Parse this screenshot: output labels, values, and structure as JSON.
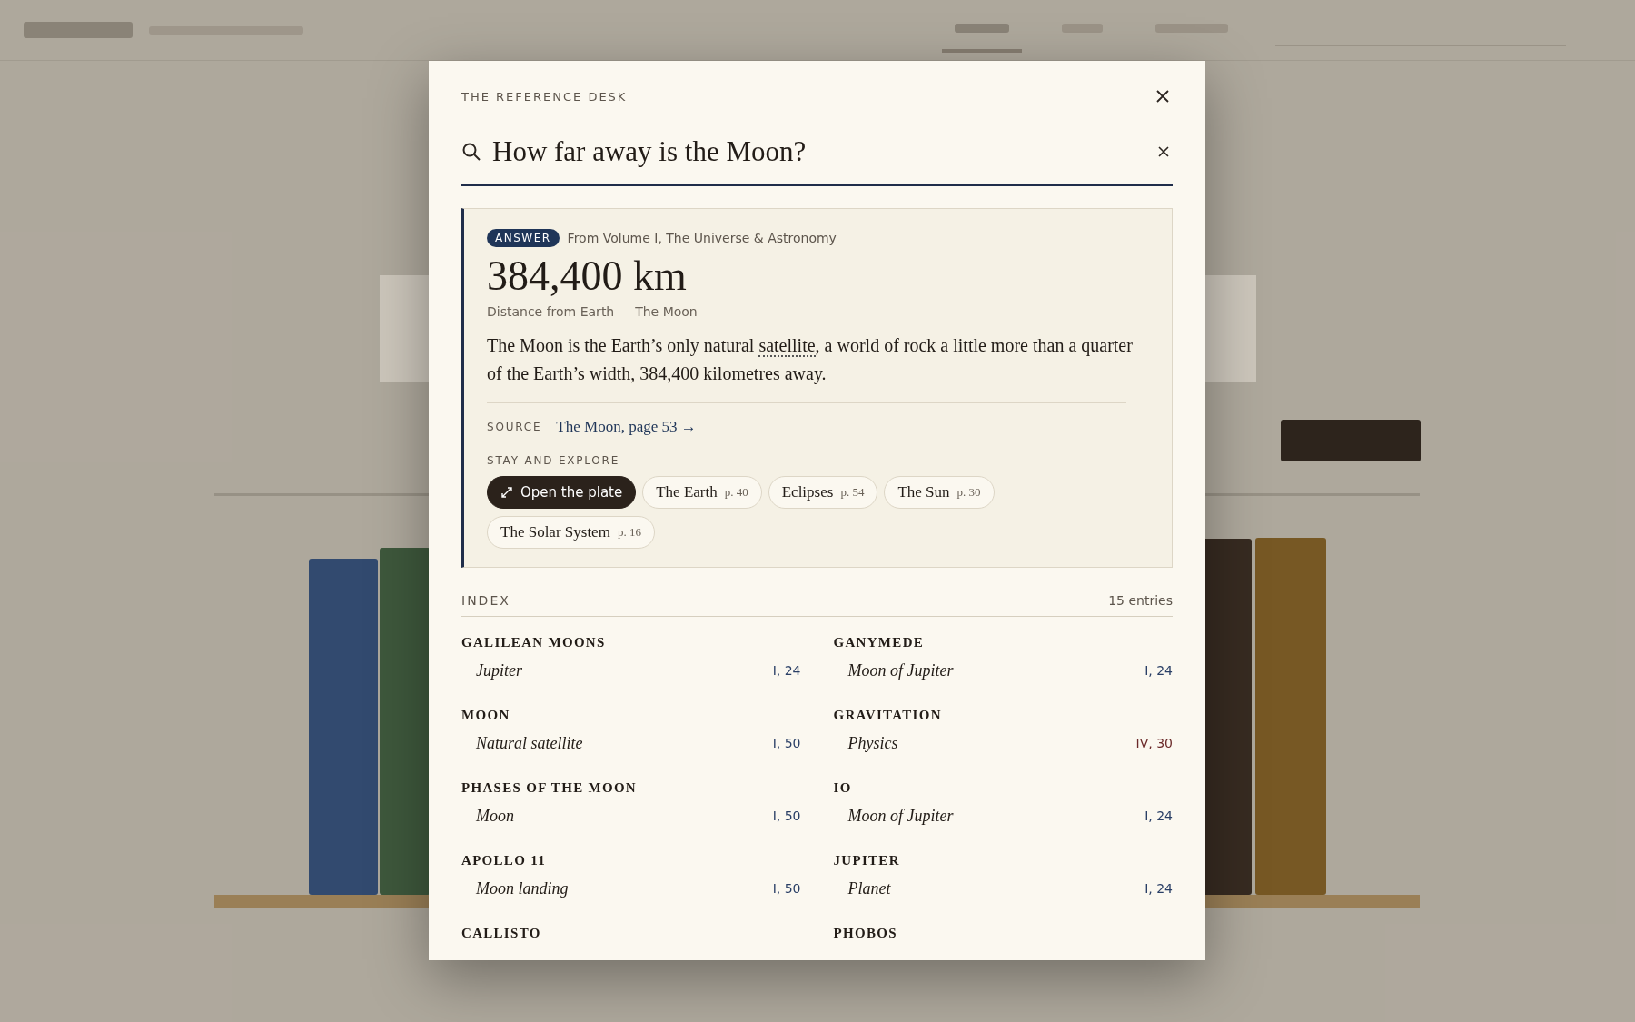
{
  "dialog": {
    "title": "THE REFERENCE DESK",
    "search": {
      "value": "How far away is the Moon?"
    },
    "answer": {
      "badge": "ANSWER",
      "from": "From Volume I, The Universe & Astronomy",
      "value": "384,400 km",
      "caption": "Distance from Earth — The Moon",
      "text_before": "The Moon is the Earth’s only natural ",
      "term": "satellite",
      "text_after": ", a world of rock a little more than a quarter of the Earth’s width, 384,400 kilometres away.",
      "source_label": "SOURCE",
      "source_link": "The Moon, page 53 →",
      "explore_label": "STAY AND EXPLORE",
      "chips": [
        {
          "kind": "action",
          "label": "Open the plate"
        },
        {
          "kind": "link",
          "label": "The Earth",
          "page": "p. 40"
        },
        {
          "kind": "link",
          "label": "Eclipses",
          "page": "p. 54"
        },
        {
          "kind": "link",
          "label": "The Sun",
          "page": "p. 30"
        },
        {
          "kind": "link",
          "label": "The Solar System",
          "page": "p. 16"
        }
      ]
    },
    "index": {
      "title": "INDEX",
      "count": "15 entries",
      "entries": [
        {
          "heading": "GALILEAN MOONS",
          "sub": "Jupiter",
          "ref": "I, 24",
          "color": "#2a3f66"
        },
        {
          "heading": "GANYMEDE",
          "sub": "Moon of Jupiter",
          "ref": "I, 24",
          "color": "#2a3f66"
        },
        {
          "heading": "MOON",
          "sub": "Natural satellite",
          "ref": "I, 50",
          "color": "#2a3f66"
        },
        {
          "heading": "GRAVITATION",
          "sub": "Physics",
          "ref": "IV, 30",
          "color": "#6b2a2a"
        },
        {
          "heading": "PHASES OF THE MOON",
          "sub": "Moon",
          "ref": "I, 50",
          "color": "#2a3f66"
        },
        {
          "heading": "IO",
          "sub": "Moon of Jupiter",
          "ref": "I, 24",
          "color": "#2a3f66"
        },
        {
          "heading": "APOLLO 11",
          "sub": "Moon landing",
          "ref": "I, 50",
          "color": "#2a3f66"
        },
        {
          "heading": "JUPITER",
          "sub": "Planet",
          "ref": "I, 24",
          "color": "#2a3f66"
        },
        {
          "heading": "CALLISTO"
        },
        {
          "heading": "PHOBOS"
        }
      ]
    }
  }
}
